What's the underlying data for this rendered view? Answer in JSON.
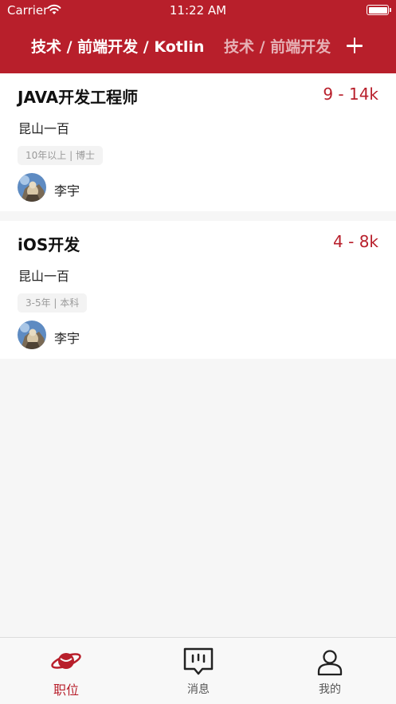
{
  "status_bar": {
    "carrier": "Carrier",
    "time": "11:22 AM"
  },
  "header": {
    "tabs": [
      {
        "label": "技术 / 前端开发 / Kotlin",
        "active": true
      },
      {
        "label": "技术 / 前端开发",
        "active": false
      }
    ],
    "accent_color": "#b81f2b"
  },
  "jobs": [
    {
      "title": "JAVA开发工程师",
      "salary": "9 - 14k",
      "company": "昆山一百",
      "requirements": "10年以上 | 博士",
      "recruiter": "李宇"
    },
    {
      "title": "iOS开发",
      "salary": "4 - 8k",
      "company": "昆山一百",
      "requirements": "3-5年 | 本科",
      "recruiter": "李宇"
    }
  ],
  "tabbar": {
    "items": [
      {
        "label": "职位",
        "icon": "planet-icon",
        "active": true
      },
      {
        "label": "消息",
        "icon": "message-icon",
        "active": false
      },
      {
        "label": "我的",
        "icon": "person-icon",
        "active": false
      }
    ]
  }
}
